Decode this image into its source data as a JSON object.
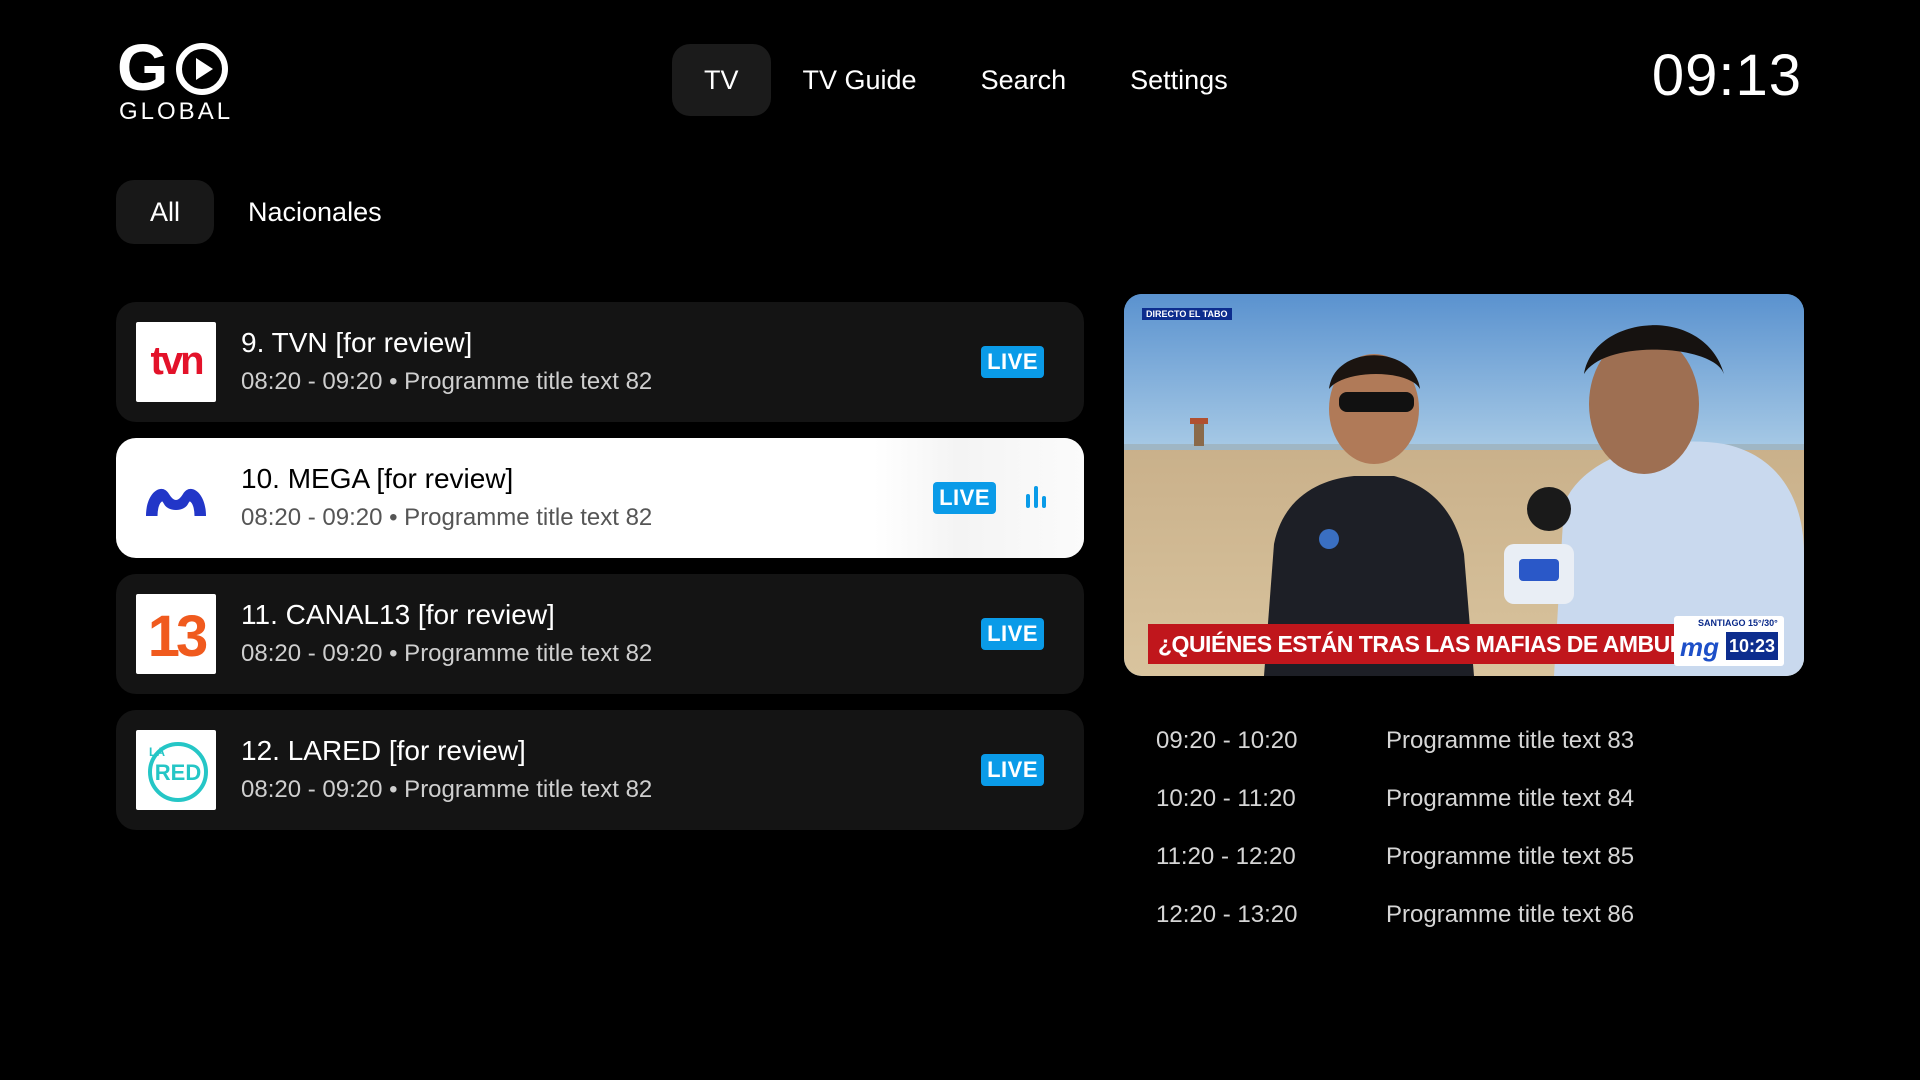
{
  "brand": {
    "logo_word": "GO",
    "logo_sub": "GLOBAL"
  },
  "nav": {
    "items": [
      {
        "label": "TV",
        "active": true
      },
      {
        "label": "TV Guide",
        "active": false
      },
      {
        "label": "Search",
        "active": false
      },
      {
        "label": "Settings",
        "active": false
      }
    ]
  },
  "clock": "09:13",
  "filters": [
    {
      "label": "All",
      "active": true
    },
    {
      "label": "Nacionales",
      "active": false
    }
  ],
  "channels": [
    {
      "name": "9. TVN [for review]",
      "programme": "08:20 - 09:20 • Programme title text 82",
      "badge": "LIVE",
      "selected": false,
      "logo": "TVN"
    },
    {
      "name": "10. MEGA [for review]",
      "programme": "08:20 - 09:20 • Programme title text 82",
      "badge": "LIVE",
      "selected": true,
      "logo": "MEGA"
    },
    {
      "name": "11. CANAL13 [for review]",
      "programme": "08:20 - 09:20 • Programme title text 82",
      "badge": "LIVE",
      "selected": false,
      "logo": "13"
    },
    {
      "name": "12. LARED [for review]",
      "programme": "08:20 - 09:20 • Programme title text 82",
      "badge": "LIVE",
      "selected": false,
      "logo": "LA RED"
    }
  ],
  "preview": {
    "directo": "DIRECTO EL TABO",
    "ticker": "¿QUIÉNES ESTÁN TRAS LAS MAFIAS DE AMBULANTES EN EL LITORAL?",
    "bug_location": "SANTIAGO 15°/30°",
    "bug_brand": "mg",
    "bug_time": "10:23"
  },
  "schedule": [
    {
      "time": "09:20 - 10:20",
      "title": "Programme title text 83"
    },
    {
      "time": "10:20 - 11:20",
      "title": "Programme title text 84"
    },
    {
      "time": "11:20 - 12:20",
      "title": "Programme title text 85"
    },
    {
      "time": "12:20 - 13:20",
      "title": "Programme title text 86"
    }
  ],
  "colors": {
    "live_badge": "#0a9be8",
    "background": "#000000",
    "card": "#141414",
    "selected_card": "#ffffff",
    "ticker": "#c0161c"
  },
  "icons": {
    "now_playing": "equalizer-icon",
    "logo_play": "play-circle-icon"
  }
}
